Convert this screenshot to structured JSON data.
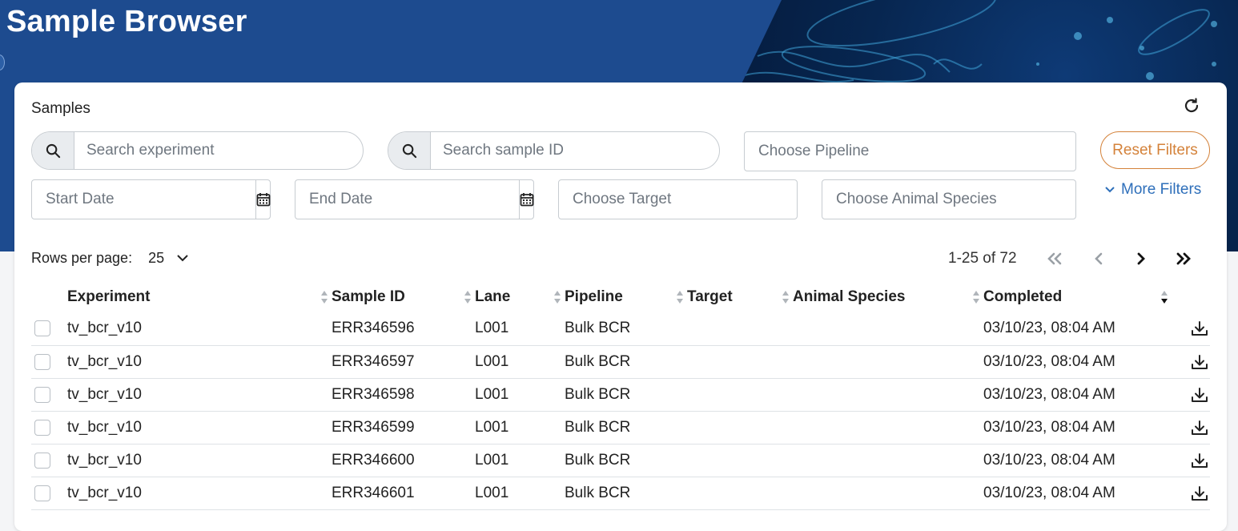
{
  "page": {
    "title": "Sample Browser"
  },
  "samples_card": {
    "title": "Samples",
    "filters": {
      "search_experiment_placeholder": "Search experiment",
      "search_sample_placeholder": "Search sample ID",
      "pipeline_placeholder": "Choose Pipeline",
      "start_date_placeholder": "Start Date",
      "end_date_placeholder": "End Date",
      "target_placeholder": "Choose Target",
      "animal_species_placeholder": "Choose Animal Species",
      "reset_label": "Reset Filters",
      "more_filters_label": "More Filters"
    },
    "pagination": {
      "rows_per_page_label": "Rows per page:",
      "rows_per_page_value": "25",
      "range_text": "1-25 of 72"
    },
    "table": {
      "columns": [
        "Experiment",
        "Sample ID",
        "Lane",
        "Pipeline",
        "Target",
        "Animal Species",
        "Completed"
      ],
      "rows": [
        {
          "experiment": "tv_bcr_v10",
          "sample_id": "ERR346596",
          "lane": "L001",
          "pipeline": "Bulk BCR",
          "target": "",
          "animal_species": "",
          "completed": "03/10/23, 08:04 AM"
        },
        {
          "experiment": "tv_bcr_v10",
          "sample_id": "ERR346597",
          "lane": "L001",
          "pipeline": "Bulk BCR",
          "target": "",
          "animal_species": "",
          "completed": "03/10/23, 08:04 AM"
        },
        {
          "experiment": "tv_bcr_v10",
          "sample_id": "ERR346598",
          "lane": "L001",
          "pipeline": "Bulk BCR",
          "target": "",
          "animal_species": "",
          "completed": "03/10/23, 08:04 AM"
        },
        {
          "experiment": "tv_bcr_v10",
          "sample_id": "ERR346599",
          "lane": "L001",
          "pipeline": "Bulk BCR",
          "target": "",
          "animal_species": "",
          "completed": "03/10/23, 08:04 AM"
        },
        {
          "experiment": "tv_bcr_v10",
          "sample_id": "ERR346600",
          "lane": "L001",
          "pipeline": "Bulk BCR",
          "target": "",
          "animal_species": "",
          "completed": "03/10/23, 08:04 AM"
        },
        {
          "experiment": "tv_bcr_v10",
          "sample_id": "ERR346601",
          "lane": "L001",
          "pipeline": "Bulk BCR",
          "target": "",
          "animal_species": "",
          "completed": "03/10/23, 08:04 AM"
        }
      ]
    }
  },
  "colors": {
    "banner": "#1d4b8f",
    "banner_dark": "#031533",
    "accent_orange": "#d4823a",
    "link_blue": "#2e6fba"
  },
  "icons": [
    "refresh-icon",
    "search-icon",
    "calendar-icon",
    "chevron-down-icon",
    "first-page-icon",
    "previous-page-icon",
    "next-page-icon",
    "last-page-icon",
    "sort-icon",
    "download-icon"
  ]
}
